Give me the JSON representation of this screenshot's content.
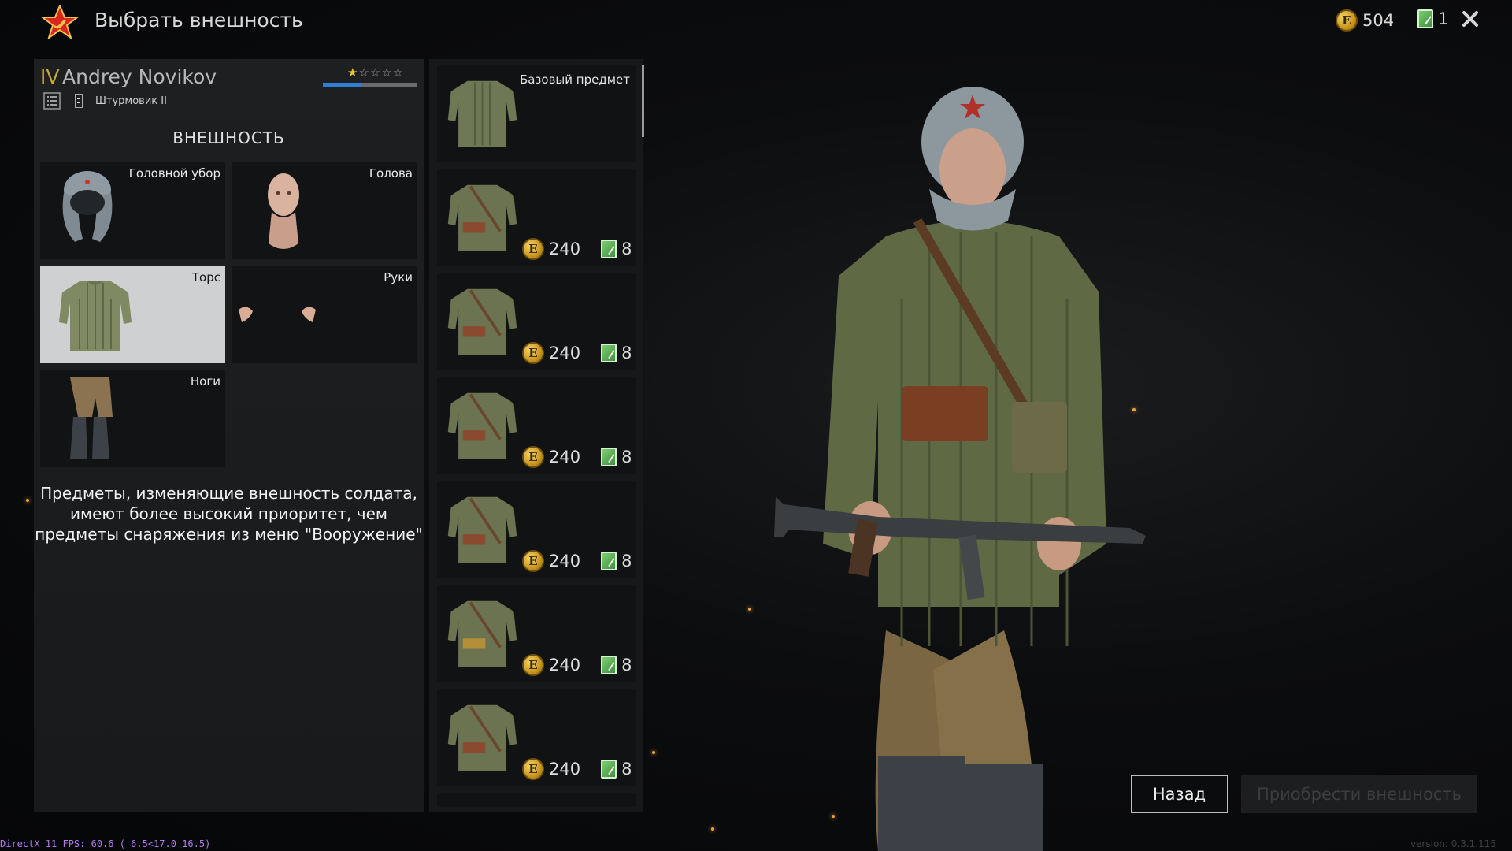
{
  "header": {
    "title": "Выбрать внешность",
    "coins": "504",
    "tickets": "1",
    "emblem_icon": "soviet-star-icon",
    "close_icon": "close-icon"
  },
  "soldier": {
    "rank": "IV",
    "name": "Andrey Novikov",
    "stars_filled": 1,
    "stars_total": 5,
    "xp_progress": 0.4,
    "class_name": "Штурмовик II"
  },
  "appearance": {
    "title": "ВНЕШНОСТЬ",
    "slots": [
      {
        "label": "Головной убор",
        "icon": "ushanka-hat-icon"
      },
      {
        "label": "Голова",
        "icon": "head-icon"
      },
      {
        "label": "Торс",
        "icon": "quilted-jacket-icon",
        "selected": true
      },
      {
        "label": "Руки",
        "icon": "hands-icon"
      },
      {
        "label": "Ноги",
        "icon": "trousers-boots-icon"
      }
    ],
    "info": [
      "Предметы, изменяющие внешность солдата,",
      "имеют более высокий приоритет, чем",
      "предметы снаряжения из меню \"Вооружение\""
    ]
  },
  "items": [
    {
      "label": "Базовый предмет",
      "icon": "jacket-icon"
    },
    {
      "coins": "240",
      "tickets": "8",
      "icon": "jacket-with-gear-icon"
    },
    {
      "coins": "240",
      "tickets": "8",
      "icon": "jacket-with-gear-icon"
    },
    {
      "coins": "240",
      "tickets": "8",
      "icon": "jacket-with-gear-icon"
    },
    {
      "coins": "240",
      "tickets": "8",
      "icon": "jacket-with-gear-icon"
    },
    {
      "coins": "240",
      "tickets": "8",
      "icon": "jacket-with-gear-icon"
    },
    {
      "coins": "240",
      "tickets": "8",
      "icon": "jacket-with-gear-icon"
    }
  ],
  "buttons": {
    "back": "Назад",
    "buy": "Приобрести внешность"
  },
  "footer": {
    "fps": "DirectX 11 FPS: 60.6 ( 6.5<17.0 16.5)",
    "version": "version: 0.3.1.115"
  },
  "colors": {
    "rank": "#c9a63a",
    "xp": "#2f7fd2",
    "background": "#0c0d0f",
    "fps_text": "#b27ae8"
  }
}
